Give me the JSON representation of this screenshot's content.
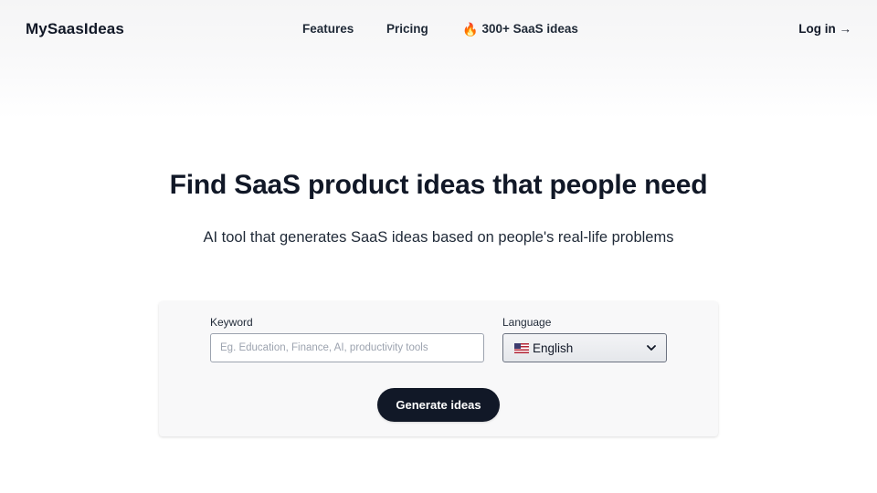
{
  "header": {
    "logo": "MySaasIdeas",
    "nav": {
      "features": "Features",
      "pricing": "Pricing",
      "ideas_icon": "🔥",
      "ideas": "300+ SaaS ideas"
    },
    "login": "Log in →"
  },
  "hero": {
    "title": "Find SaaS product ideas that people need",
    "subtitle": "AI tool that generates SaaS ideas based on people's real-life problems"
  },
  "form": {
    "keyword_label": "Keyword",
    "keyword_value": "",
    "keyword_placeholder": "Eg. Education, Finance, AI, productivity tools",
    "language_label": "Language",
    "language_value": "English",
    "language_flag_icon": "us-flag-icon",
    "generate_label": "Generate ideas"
  },
  "colors": {
    "primary_button": "#111827",
    "text": "#111827",
    "card_background": "#f8f8f9"
  }
}
